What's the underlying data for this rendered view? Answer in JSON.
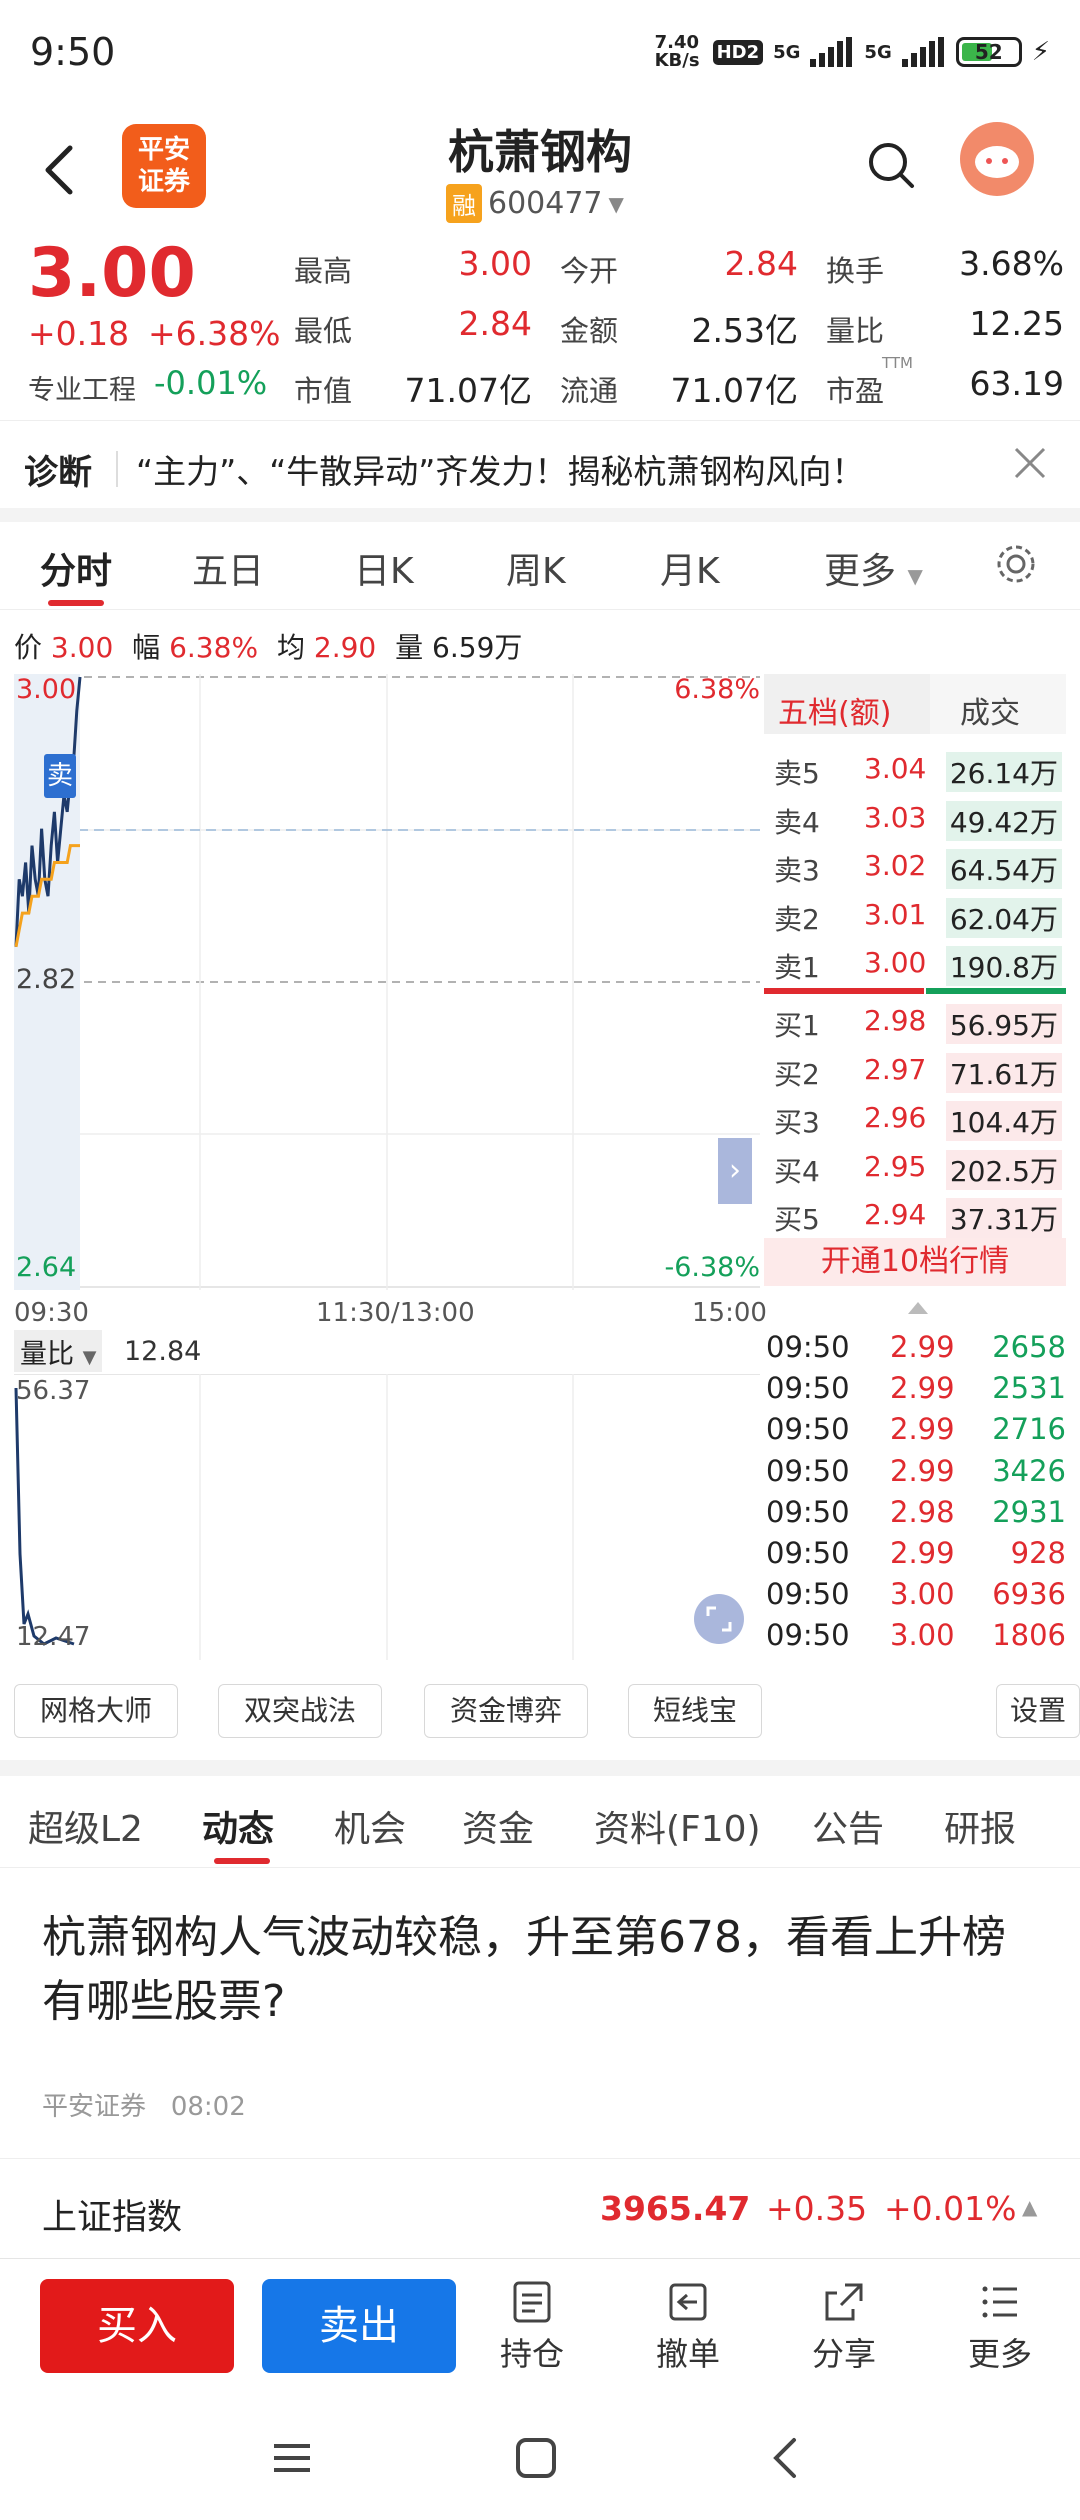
{
  "status_bar": {
    "time": "9:50",
    "net_speed": "7.40\nKB/s",
    "hd": "HD2",
    "net1": "5G",
    "net2": "5G",
    "battery": "52"
  },
  "header": {
    "title": "杭萧钢构",
    "code": "600477",
    "rong": "融",
    "logo_line1": "平安",
    "logo_line2": "证券"
  },
  "quote": {
    "price": "3.00",
    "change": "+0.18",
    "change_pct": "+6.38%",
    "sector": "专业工程",
    "sector_pct": "-0.01%",
    "rows": [
      [
        {
          "label": "最高",
          "value": "3.00",
          "color": "red"
        },
        {
          "label": "今开",
          "value": "2.84",
          "color": "red"
        },
        {
          "label": "换手",
          "value": "3.68%",
          "color": "dark"
        }
      ],
      [
        {
          "label": "最低",
          "value": "2.84",
          "color": "red"
        },
        {
          "label": "金额",
          "value": "2.53亿",
          "color": "dark"
        },
        {
          "label": "量比",
          "value": "12.25",
          "color": "dark"
        }
      ],
      [
        {
          "label": "市值",
          "value": "71.07亿",
          "color": "dark"
        },
        {
          "label": "流通",
          "value": "71.07亿",
          "color": "dark"
        },
        {
          "label": "市盈",
          "value": "63.19",
          "color": "dark"
        }
      ]
    ],
    "pe_sup": "TTM"
  },
  "diagnosis": {
    "label": "诊断",
    "text": "“主力”、“牛散异动”齐发力！揭秘杭萧钢构风向！"
  },
  "kline_tabs": [
    "分时",
    "五日",
    "日K",
    "周K",
    "月K",
    "更多"
  ],
  "kline_info": {
    "price_label": "价",
    "price": "3.00",
    "amp_label": "幅",
    "amp": "6.38%",
    "avg_label": "均",
    "avg": "2.90",
    "vol_label": "量",
    "vol": "6.59万"
  },
  "chart_labels": {
    "top_price": "3.00",
    "mid_price": "2.82",
    "low_price": "2.64",
    "top_pct": "6.38%",
    "low_pct": "-6.38%",
    "t_start": "09:30",
    "t_mid": "11:30/13:00",
    "t_end": "15:00",
    "sell_tag": "卖"
  },
  "chart_data": {
    "type": "line",
    "x": [
      "09:30",
      "09:31",
      "09:32",
      "09:33",
      "09:34",
      "09:35",
      "09:36",
      "09:37",
      "09:38",
      "09:39",
      "09:40",
      "09:41",
      "09:42",
      "09:43",
      "09:44",
      "09:45",
      "09:46",
      "09:47",
      "09:48",
      "09:49",
      "09:50"
    ],
    "series": [
      {
        "values": [
          2.84,
          2.88,
          2.87,
          2.89,
          2.86,
          2.9,
          2.88,
          2.87,
          2.91,
          2.88,
          2.87,
          2.9,
          2.92,
          2.89,
          2.91,
          2.93,
          2.92,
          2.94,
          2.95,
          2.98,
          3.0
        ]
      },
      {
        "values": [
          2.84,
          2.85,
          2.86,
          2.86,
          2.86,
          2.87,
          2.87,
          2.87,
          2.88,
          2.88,
          2.88,
          2.88,
          2.89,
          2.89,
          2.89,
          2.89,
          2.89,
          2.9,
          2.9,
          2.9,
          2.9
        ]
      }
    ],
    "ylim": [
      2.64,
      3.0
    ]
  },
  "volume_ratio": {
    "label": "量比",
    "value": "12.84",
    "top": "56.37",
    "bottom": "12.47"
  },
  "order_book": {
    "tab1": "五档(额)",
    "tab2": "成交",
    "asks": [
      {
        "label": "卖5",
        "price": "3.04",
        "vol": "26.14万"
      },
      {
        "label": "卖4",
        "price": "3.03",
        "vol": "49.42万"
      },
      {
        "label": "卖3",
        "price": "3.02",
        "vol": "64.54万"
      },
      {
        "label": "卖2",
        "price": "3.01",
        "vol": "62.04万"
      },
      {
        "label": "卖1",
        "price": "3.00",
        "vol": "190.8万"
      }
    ],
    "bids": [
      {
        "label": "买1",
        "price": "2.98",
        "vol": "56.95万"
      },
      {
        "label": "买2",
        "price": "2.97",
        "vol": "71.61万"
      },
      {
        "label": "买3",
        "price": "2.96",
        "vol": "104.4万"
      },
      {
        "label": "买4",
        "price": "2.95",
        "vol": "202.5万"
      },
      {
        "label": "买5",
        "price": "2.94",
        "vol": "37.31万"
      }
    ],
    "open10": "开通10档行情"
  },
  "trades": [
    {
      "time": "09:50",
      "price": "2.99",
      "vol": "2658"
    },
    {
      "time": "09:50",
      "price": "2.99",
      "vol": "2531"
    },
    {
      "time": "09:50",
      "price": "2.99",
      "vol": "2716"
    },
    {
      "time": "09:50",
      "price": "2.99",
      "vol": "3426"
    },
    {
      "time": "09:50",
      "price": "2.98",
      "vol": "2931"
    },
    {
      "time": "09:50",
      "price": "2.99",
      "vol": "928"
    },
    {
      "time": "09:50",
      "price": "3.00",
      "vol": "6936"
    },
    {
      "time": "09:50",
      "price": "3.00",
      "vol": "1806"
    }
  ],
  "tools": [
    "网格大师",
    "双突战法",
    "资金博弈",
    "短线宝",
    "设置"
  ],
  "bottom_tabs": [
    "超级L2",
    "动态",
    "机会",
    "资金",
    "资料(F10)",
    "公告",
    "研报"
  ],
  "news": {
    "title": "杭萧钢构人气波动较稳，升至第678，看看上升榜有哪些股票?",
    "source": "平安证券",
    "time": "08:02"
  },
  "index": {
    "name": "上证指数",
    "value": "3965.47",
    "change": "+0.35",
    "pct": "+0.01%"
  },
  "actions": {
    "buy": "买入",
    "sell": "卖出",
    "hold": "持仓",
    "cancel": "撤单",
    "share": "分享",
    "more": "更多"
  }
}
